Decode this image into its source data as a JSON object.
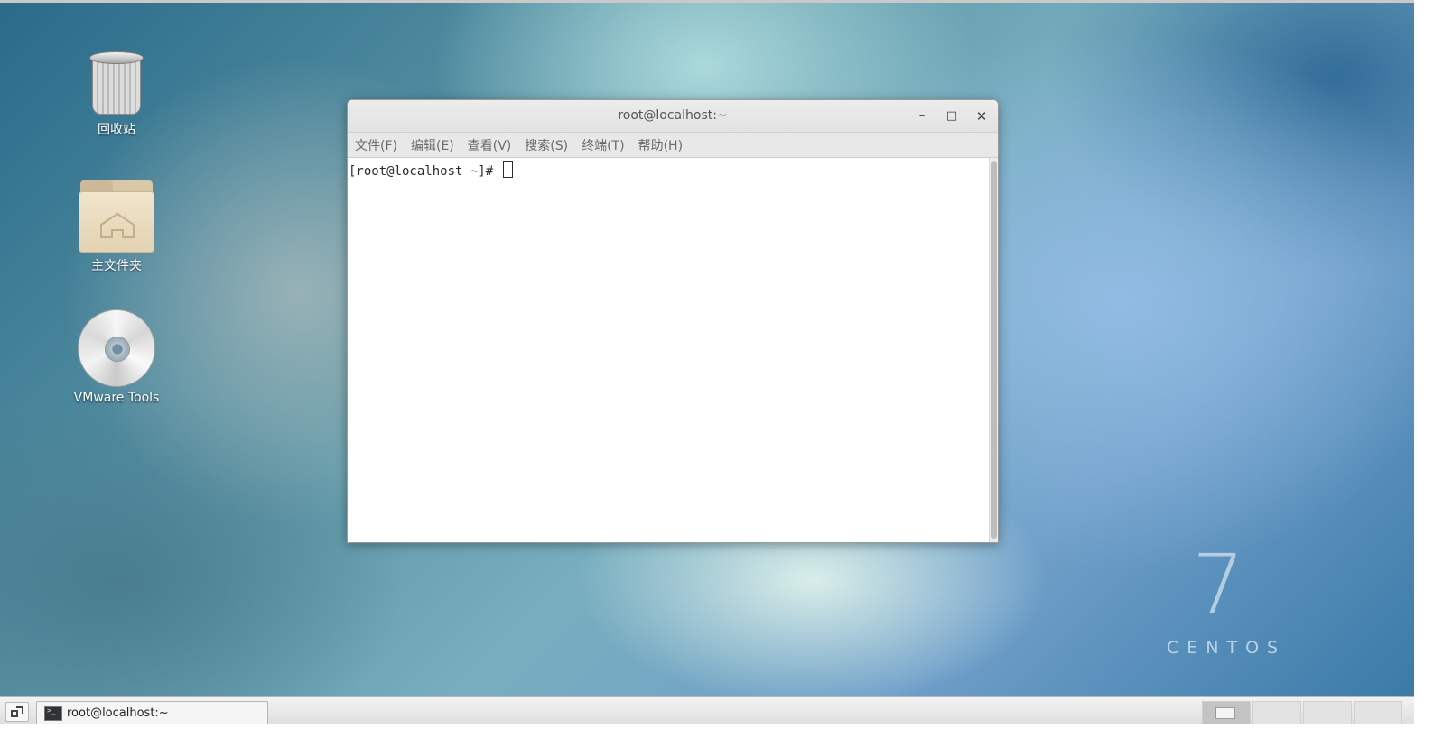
{
  "desktop": {
    "icons": [
      {
        "label": "回收站",
        "icon": "trash-icon"
      },
      {
        "label": "主文件夹",
        "icon": "home-folder-icon"
      },
      {
        "label": "VMware Tools",
        "icon": "disc-icon"
      }
    ],
    "branding": {
      "number": "7",
      "word": "CENTOS"
    }
  },
  "window": {
    "title": "root@localhost:~",
    "controls": {
      "minimize": "–",
      "maximize": "□",
      "close": "✕"
    },
    "menu": [
      "文件(F)",
      "编辑(E)",
      "查看(V)",
      "搜索(S)",
      "终端(T)",
      "帮助(H)"
    ],
    "terminal": {
      "prompt": "[root@localhost ~]# "
    }
  },
  "taskbar": {
    "tasks": [
      {
        "label": "root@localhost:~",
        "icon": "terminal-icon"
      }
    ],
    "workspaces": {
      "count": 4,
      "active": 1
    }
  }
}
